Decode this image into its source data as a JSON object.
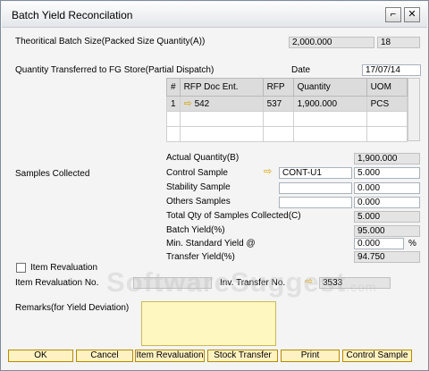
{
  "window": {
    "title": "Batch Yield Reconcilation",
    "minimize_glyph": "⌐",
    "close_glyph": "✕"
  },
  "theoretical": {
    "label": "Theoritical Batch Size(Packed Size Quantity(A))",
    "value": "2,000.000",
    "extra": "18"
  },
  "transfer": {
    "label": "Quantity Transferred to FG Store(Partial Dispatch)",
    "date_label": "Date",
    "date_value": "17/07/14"
  },
  "grid": {
    "headers": [
      "#",
      "RFP Doc Ent.",
      "RFP",
      "Quantity",
      "UOM"
    ],
    "rows": [
      {
        "num": "1",
        "doc_ent": "542",
        "rfp": "537",
        "quantity": "1,900.000",
        "uom": "PCS"
      }
    ]
  },
  "samples": {
    "section_label": "Samples Collected",
    "actual_label": "Actual Quantity(B)",
    "actual_value": "1,900.000",
    "control_label": "Control Sample",
    "control_code": "CONT-U1",
    "control_value": "5.000",
    "stability_label": "Stability Sample",
    "stability_value": "0.000",
    "others_label": "Others Samples",
    "others_value": "0.000",
    "total_label": "Total Qty of Samples Collected(C)",
    "total_value": "5.000",
    "batch_label": "Batch Yield(%)",
    "batch_value": "95.000",
    "minstd_label": "Min. Standard Yield @",
    "minstd_value": "0.000",
    "minstd_unit": "%",
    "transfer_yield_label": "Transfer Yield(%)",
    "transfer_yield_value": "94.750"
  },
  "revaluation": {
    "checkbox_label": "Item Revaluation",
    "no_label": "Item Revaluation No.",
    "no_value": "",
    "inv_label": "Inv. Transfer No.",
    "inv_value": "3533"
  },
  "remarks": {
    "label": "Remarks(for Yield Deviation)",
    "value": ""
  },
  "buttons": {
    "ok": "OK",
    "cancel": "Cancel",
    "item_revaluation": "Item Revaluation",
    "stock_transfer": "Stock Transfer",
    "print": "Print",
    "control_sample": "Control Sample"
  },
  "watermark": {
    "brand": "SoftwareSuggest",
    "suffix": ".com"
  },
  "icons": {
    "link_arrow": "right-arrow-icon",
    "checkbox": "checkbox-icon"
  },
  "colors": {
    "accent_button": "#fff2c2",
    "remarks_bg": "#fff7bf",
    "arrow": "#d8a400"
  }
}
